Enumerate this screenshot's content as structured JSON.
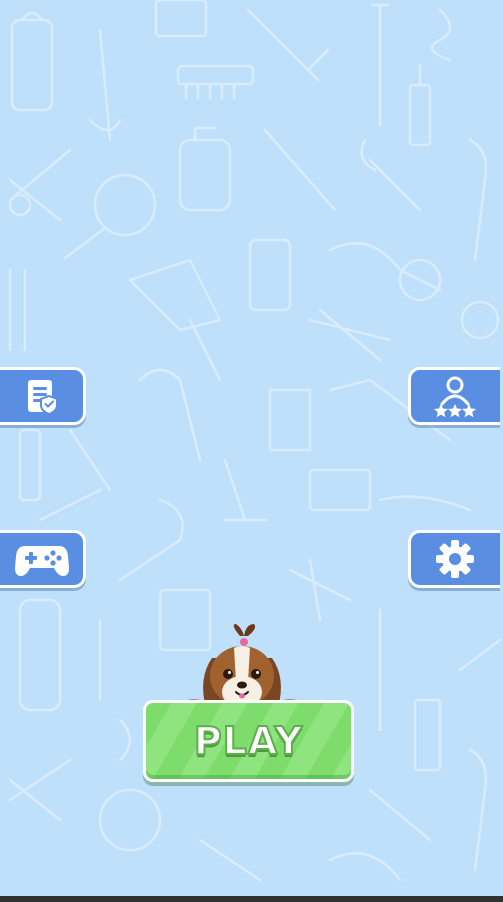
{
  "menu": {
    "left_buttons": [
      {
        "id": "tasks",
        "icon": "clipboard-check-icon"
      },
      {
        "id": "games",
        "icon": "gamepad-icon"
      }
    ],
    "right_buttons": [
      {
        "id": "rating",
        "icon": "user-stars-icon"
      },
      {
        "id": "settings",
        "icon": "gear-icon"
      }
    ],
    "play_label": "PLAY",
    "mascot": "shih-tzu-dog-icon"
  },
  "colors": {
    "background": "#bfe0fb",
    "button_blue": "#5a8ee3",
    "play_green": "#7ddc6b",
    "pattern": "#d9ecfd"
  }
}
